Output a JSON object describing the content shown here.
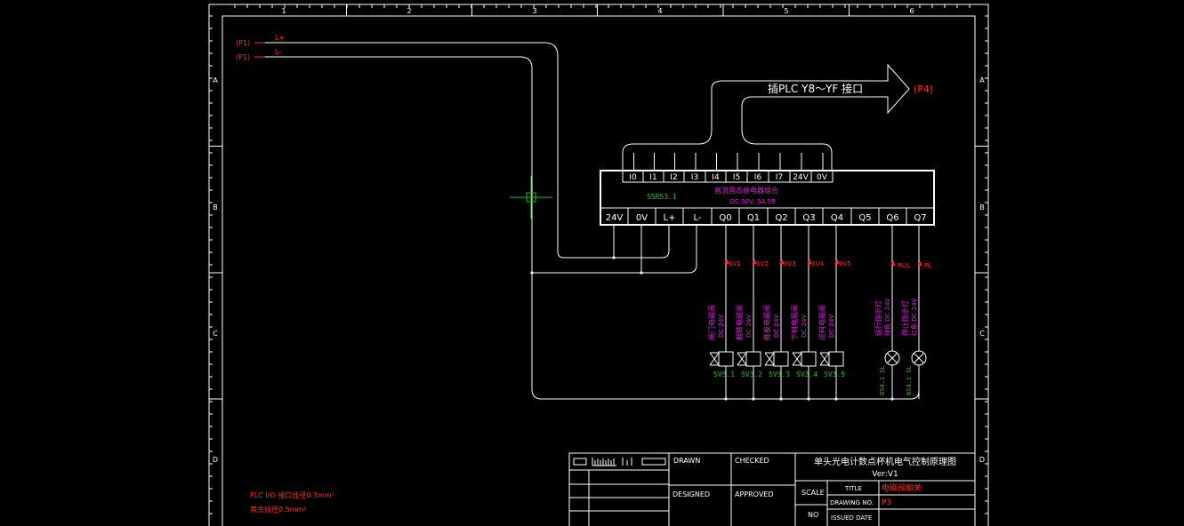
{
  "colors": {
    "background": "#000000",
    "frame": "#ffffff",
    "wire": "#ffffff",
    "annotation_red": "#ff2a2a",
    "label_magenta": "#e020e0",
    "label_green": "#20c020",
    "cursor": "#20c020"
  },
  "frame": {
    "col_numbers": [
      "1",
      "2",
      "3",
      "4",
      "5",
      "6"
    ],
    "row_letters": [
      "A",
      "B",
      "C",
      "D"
    ]
  },
  "power_inputs": [
    {
      "ref": "(P1)",
      "signal": "L+"
    },
    {
      "ref": "(P1)",
      "signal": "L-"
    }
  ],
  "callout": {
    "text": "插PLC Y8～YF 接口",
    "ref": "(P4)"
  },
  "module": {
    "inputs": [
      "I0",
      "I1",
      "I2",
      "I3",
      "I4",
      "I5",
      "I6",
      "I7",
      "24V",
      "0V"
    ],
    "tag": "SSRS3.1",
    "title": "直流固态继电器组合",
    "spec": "DC 50V, 5A.5P",
    "outputs": [
      "24V",
      "0V",
      "L+",
      "L-",
      "Q0",
      "Q1",
      "Q2",
      "Q3",
      "Q4",
      "Q5",
      "Q6",
      "Q7"
    ]
  },
  "valves": [
    {
      "tag": "SV1",
      "desc": "闸门电磁阀",
      "volt": "DC 24V",
      "id": "SV3.1"
    },
    {
      "tag": "SV2",
      "desc": "翻转电磁阀",
      "volt": "DC 24V",
      "id": "SV3.2"
    },
    {
      "tag": "SV3",
      "desc": "推板电磁阀",
      "volt": "DC 24V",
      "id": "SV3.3"
    },
    {
      "tag": "SV4",
      "desc": "下料电磁阀",
      "volt": "DC 24V",
      "id": "SV3.4"
    },
    {
      "tag": "SV5",
      "desc": "送料电磁阀",
      "volt": "DC 24V",
      "id": "SV3.5"
    }
  ],
  "lamps": [
    {
      "tag": "RUL",
      "desc": "运行指示灯",
      "volt": "绿色 DC 24V",
      "id": "BS4.1 SL"
    },
    {
      "tag": "PL",
      "desc": "停止指示灯",
      "volt": "红色 DC 24V",
      "id": "BS4.2 SL"
    }
  ],
  "notes": [
    "PLC I/O 接口线径0.3mm²",
    "其余线径0.5mm²"
  ],
  "title_block": {
    "drawn": "DRAWN",
    "checked": "CHECKED",
    "designed": "DESIGNED",
    "approved": "APPROVED",
    "drawing_title": "单头光电计数点杯机电气控制原理图",
    "version": "Ver:V1",
    "scale": "SCALE",
    "title_label": "TITLE",
    "title_value": "电磁阀相关",
    "drawing_no_label": "DRAWING NO.",
    "drawing_no_value": "P3",
    "no": "NO",
    "issued_date": "ISSUED DATE"
  }
}
